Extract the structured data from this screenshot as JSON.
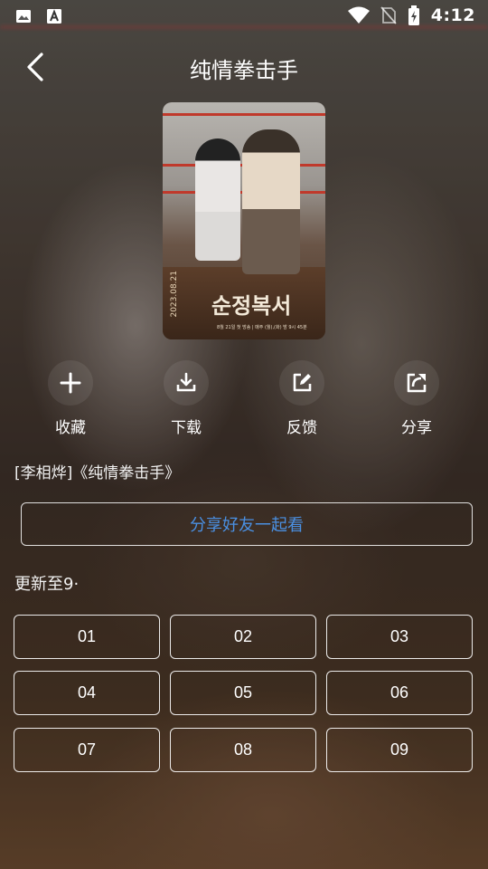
{
  "status_bar": {
    "time": "4:12"
  },
  "header": {
    "title": "纯情拳击手"
  },
  "poster": {
    "title_text": "순정복서",
    "date_text": "2023.08.21",
    "fine_text": "8월 21일 첫 방송 | 매주 (월),(화) 밤 9시 45분"
  },
  "actions": [
    {
      "label": "收藏",
      "icon": "plus-icon"
    },
    {
      "label": "下载",
      "icon": "download-icon"
    },
    {
      "label": "反馈",
      "icon": "edit-icon"
    },
    {
      "label": "分享",
      "icon": "share-icon"
    }
  ],
  "cast_line": "[李相烨]《纯情拳击手》",
  "share_friends_label": "分享好友一起看",
  "update_text": "更新至9·",
  "episodes": [
    "01",
    "02",
    "03",
    "04",
    "05",
    "06",
    "07",
    "08",
    "09"
  ],
  "colors": {
    "accent_blue": "#4a90e2",
    "poster_rope": "#c0392b"
  }
}
